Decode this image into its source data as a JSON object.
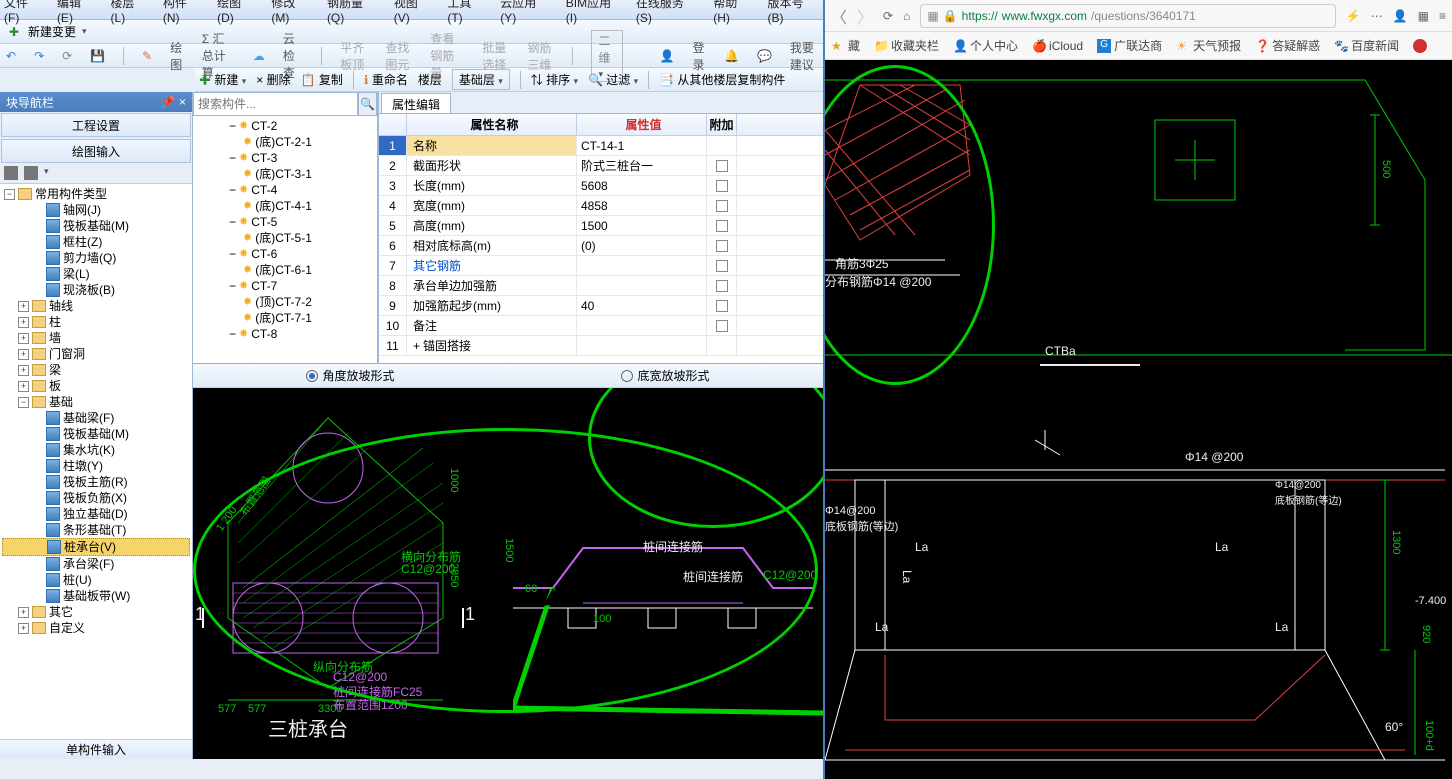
{
  "menu": {
    "items": [
      "文件(F)",
      "编辑(E)",
      "楼层(L)",
      "构件(N)",
      "绘图(D)",
      "修改(M)",
      "钢筋量(Q)",
      "视图(V)",
      "工具(T)",
      "云应用(Y)",
      "BIM应用(I)",
      "在线服务(S)",
      "帮助(H)",
      "版本号(B)"
    ]
  },
  "toolbar1": {
    "newChange": "新建变更"
  },
  "toolbar_right": {
    "login": "登录",
    "suggest": "我要建议"
  },
  "toolbar2": {
    "items": [
      "",
      "",
      "",
      "",
      "",
      "",
      "绘图",
      "Σ 汇总计算",
      "云检查",
      "平齐板顶",
      "查找图元",
      "查看钢筋量",
      "批量选择",
      "钢筋三维",
      "二维"
    ]
  },
  "comp_toolbar": {
    "new": "新建",
    "del": "× 删除",
    "copy": "复制",
    "rename": "重命名",
    "floor": "楼层",
    "base": "基础层",
    "sort": "排序",
    "filter": "过滤",
    "copyFrom": "从其他楼层复制构件"
  },
  "navpane": {
    "title": "块导航栏",
    "tabs": [
      "工程设置",
      "绘图输入"
    ],
    "footer": "单构件输入"
  },
  "tree": {
    "root": "常用构件类型",
    "items": [
      {
        "l": "轴网(J)",
        "d": 2
      },
      {
        "l": "筏板基础(M)",
        "d": 2
      },
      {
        "l": "框柱(Z)",
        "d": 2
      },
      {
        "l": "剪力墙(Q)",
        "d": 2
      },
      {
        "l": "梁(L)",
        "d": 2
      },
      {
        "l": "现浇板(B)",
        "d": 2
      },
      {
        "l": "轴线",
        "d": 1,
        "e": "+"
      },
      {
        "l": "柱",
        "d": 1,
        "e": "+"
      },
      {
        "l": "墙",
        "d": 1,
        "e": "+"
      },
      {
        "l": "门窗洞",
        "d": 1,
        "e": "+"
      },
      {
        "l": "梁",
        "d": 1,
        "e": "+"
      },
      {
        "l": "板",
        "d": 1,
        "e": "+"
      },
      {
        "l": "基础",
        "d": 1,
        "e": "-"
      },
      {
        "l": "基础梁(F)",
        "d": 2
      },
      {
        "l": "筏板基础(M)",
        "d": 2
      },
      {
        "l": "集水坑(K)",
        "d": 2
      },
      {
        "l": "柱墩(Y)",
        "d": 2
      },
      {
        "l": "筏板主筋(R)",
        "d": 2
      },
      {
        "l": "筏板负筋(X)",
        "d": 2
      },
      {
        "l": "独立基础(D)",
        "d": 2
      },
      {
        "l": "条形基础(T)",
        "d": 2
      },
      {
        "l": "桩承台(V)",
        "d": 2,
        "sel": true
      },
      {
        "l": "承台梁(F)",
        "d": 2
      },
      {
        "l": "桩(U)",
        "d": 2
      },
      {
        "l": "基础板带(W)",
        "d": 2
      },
      {
        "l": "其它",
        "d": 1,
        "e": "+"
      },
      {
        "l": "自定义",
        "d": 1,
        "e": "+"
      }
    ]
  },
  "search_placeholder": "搜索构件...",
  "comptree": [
    {
      "l": "CT-2",
      "d": 1,
      "e": "-"
    },
    {
      "l": "(底)CT-2-1",
      "d": 2
    },
    {
      "l": "CT-3",
      "d": 1,
      "e": "-"
    },
    {
      "l": "(底)CT-3-1",
      "d": 2
    },
    {
      "l": "CT-4",
      "d": 1,
      "e": "-"
    },
    {
      "l": "(底)CT-4-1",
      "d": 2
    },
    {
      "l": "CT-5",
      "d": 1,
      "e": "-"
    },
    {
      "l": "(底)CT-5-1",
      "d": 2
    },
    {
      "l": "CT-6",
      "d": 1,
      "e": "-"
    },
    {
      "l": "(底)CT-6-1",
      "d": 2
    },
    {
      "l": "CT-7",
      "d": 1,
      "e": "-"
    },
    {
      "l": "(顶)CT-7-2",
      "d": 2
    },
    {
      "l": "(底)CT-7-1",
      "d": 2
    },
    {
      "l": "CT-8",
      "d": 1,
      "e": "-"
    }
  ],
  "proptab": "属性编辑",
  "prophdr": {
    "name": "属性名称",
    "value": "属性值",
    "add": "附加"
  },
  "props": [
    {
      "n": "1",
      "name": "名称",
      "val": "CT-14-1",
      "sel": true
    },
    {
      "n": "2",
      "name": "截面形状",
      "val": "阶式三桩台一"
    },
    {
      "n": "3",
      "name": "长度(mm)",
      "val": "5608"
    },
    {
      "n": "4",
      "name": "宽度(mm)",
      "val": "4858"
    },
    {
      "n": "5",
      "name": "高度(mm)",
      "val": "1500"
    },
    {
      "n": "6",
      "name": "相对底标高(m)",
      "val": "(0)"
    },
    {
      "n": "7",
      "name": "其它钢筋",
      "val": "",
      "blue": true
    },
    {
      "n": "8",
      "name": "承台单边加强筋",
      "val": ""
    },
    {
      "n": "9",
      "name": "加强筋起步(mm)",
      "val": "40"
    },
    {
      "n": "10",
      "name": "备注",
      "val": ""
    },
    {
      "n": "11",
      "name": "锚固搭接",
      "val": "",
      "exp": "+"
    }
  ],
  "radios": {
    "a": "角度放坡形式",
    "b": "底宽放坡形式"
  },
  "canvas": {
    "title": "三桩承台",
    "labels": {
      "hengxiang": "横向分布筋",
      "zongxiang": "纵向分布筋",
      "zhuajianlj": "桩间连接筋",
      "zhuajianlj2": "桩间连接筋",
      "buzhifw": "布置范围",
      "c12": "C12@200",
      "fc25": "桩间连接筋FC25",
      "bzfw1200": "布置范围1200",
      "d1200": "1 200",
      "d577": "577",
      "d577b": "577",
      "d3300": "3300",
      "d2850": "2850",
      "d1500": "1500",
      "d1000": "1000",
      "d60": "60",
      "d100": "100",
      "sec1": "1",
      "sec1b": "1",
      "c12b": "C12@200"
    }
  },
  "browser": {
    "url_pre": "https://",
    "url_host": "www.fwxgx.com",
    "url_path": "/questions/3640171",
    "bookmarks": [
      "藏",
      "收藏夹栏",
      "个人中心",
      "iCloud",
      "广联达商",
      "天气预报",
      "答疑解惑",
      "百度新闻"
    ],
    "cad": {
      "ctba": "CTBa",
      "jiaojin": "角筋3Φ25",
      "fenbu": "分布钢筋Φ14 @200",
      "d500": "500",
      "phi14": "Φ14 @200",
      "phi14b": "Φ14@200",
      "dibu": "底板钢筋(等边)",
      "la": "La",
      "d1300": "1300",
      "d920": "920",
      "neg7400": "-7.400",
      "d60": "60°",
      "d100d": "100+d"
    }
  }
}
